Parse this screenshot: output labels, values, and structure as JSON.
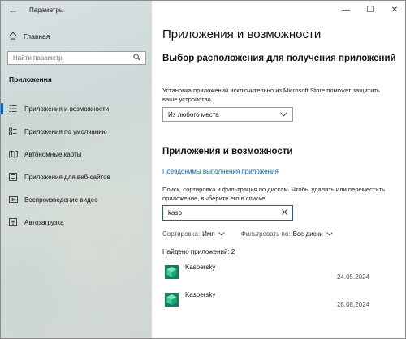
{
  "window": {
    "title": "Параметры",
    "back_icon": "back-arrow-icon",
    "controls": {
      "minimize": "—",
      "maximize": "☐",
      "close": "✕"
    }
  },
  "nav": {
    "home_label": "Главная",
    "search_placeholder": "Найти параметр",
    "section_heading": "Приложения",
    "items": [
      {
        "label": "Приложения и возможности",
        "icon": "apps-list-icon",
        "active": true
      },
      {
        "label": "Приложения по умолчанию",
        "icon": "default-apps-icon",
        "active": false
      },
      {
        "label": "Автономные карты",
        "icon": "offline-maps-icon",
        "active": false
      },
      {
        "label": "Приложения для веб-сайтов",
        "icon": "apps-for-websites-icon",
        "active": false
      },
      {
        "label": "Воспроизведение видео",
        "icon": "video-playback-icon",
        "active": false
      },
      {
        "label": "Автозагрузка",
        "icon": "startup-icon",
        "active": false
      }
    ]
  },
  "content": {
    "page_title": "Приложения и возможности",
    "install_section": {
      "heading": "Выбор расположения для получения приложений",
      "description": "Установка приложений исключительно из Microsoft Store поможет защитить ваше устройство.",
      "dropdown_value": "Из любого места"
    },
    "apps_section": {
      "heading": "Приложения и возможности",
      "aliases_link": "Псевдонимы выполнения приложения",
      "description": "Поиск, сортировка и фильтрация по дискам. Чтобы удалить или переместить приложение, выберите его в списке.",
      "search_value": "kasp",
      "sort_label": "Сортировка:",
      "sort_value": "Имя",
      "filter_label": "Фильтровать по:",
      "filter_value": "Все диски",
      "found_text": "Найдено приложений: 2",
      "apps": [
        {
          "name": "Kaspersky",
          "date": "24.05.2024"
        },
        {
          "name": "Kaspersky",
          "date": "28.08.2024"
        }
      ]
    }
  },
  "colors": {
    "accent": "#0067c0",
    "kaspersky_green": "#1fa37a"
  }
}
